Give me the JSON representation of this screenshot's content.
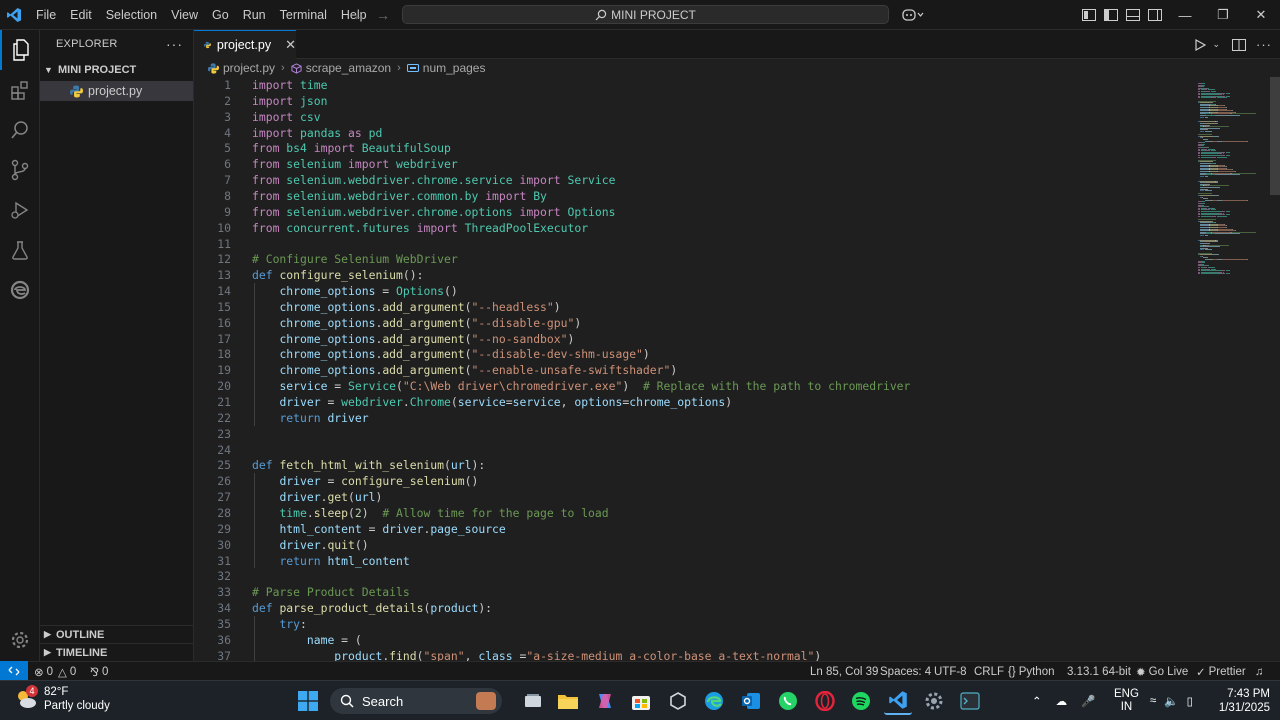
{
  "titlebar": {
    "menus": [
      "File",
      "Edit",
      "Selection",
      "View",
      "Go",
      "Run",
      "Terminal",
      "Help"
    ],
    "command_center": "MINI PROJECT"
  },
  "sidebar": {
    "title": "EXPLORER",
    "folder": "MINI PROJECT",
    "file": "project.py",
    "outline": "OUTLINE",
    "timeline": "TIMELINE"
  },
  "tab": {
    "label": "project.py"
  },
  "breadcrumb": {
    "file": "project.py",
    "function": "scrape_amazon",
    "variable": "num_pages"
  },
  "editor": {
    "lines": [
      [
        [
          "kw",
          "import"
        ],
        [
          "p",
          " "
        ],
        [
          "mod",
          "time"
        ]
      ],
      [
        [
          "kw",
          "import"
        ],
        [
          "p",
          " "
        ],
        [
          "mod",
          "json"
        ]
      ],
      [
        [
          "kw",
          "import"
        ],
        [
          "p",
          " "
        ],
        [
          "mod",
          "csv"
        ]
      ],
      [
        [
          "kw",
          "import"
        ],
        [
          "p",
          " "
        ],
        [
          "mod",
          "pandas"
        ],
        [
          "p",
          " "
        ],
        [
          "kw",
          "as"
        ],
        [
          "p",
          " "
        ],
        [
          "mod",
          "pd"
        ]
      ],
      [
        [
          "kw",
          "from"
        ],
        [
          "p",
          " "
        ],
        [
          "mod",
          "bs4"
        ],
        [
          "p",
          " "
        ],
        [
          "kw",
          "import"
        ],
        [
          "p",
          " "
        ],
        [
          "cls",
          "BeautifulSoup"
        ]
      ],
      [
        [
          "kw",
          "from"
        ],
        [
          "p",
          " "
        ],
        [
          "mod",
          "selenium"
        ],
        [
          "p",
          " "
        ],
        [
          "kw",
          "import"
        ],
        [
          "p",
          " "
        ],
        [
          "mod",
          "webdriver"
        ]
      ],
      [
        [
          "kw",
          "from"
        ],
        [
          "p",
          " "
        ],
        [
          "mod",
          "selenium.webdriver.chrome.service"
        ],
        [
          "p",
          " "
        ],
        [
          "kw",
          "import"
        ],
        [
          "p",
          " "
        ],
        [
          "cls",
          "Service"
        ]
      ],
      [
        [
          "kw",
          "from"
        ],
        [
          "p",
          " "
        ],
        [
          "mod",
          "selenium.webdriver.common.by"
        ],
        [
          "p",
          " "
        ],
        [
          "kw",
          "import"
        ],
        [
          "p",
          " "
        ],
        [
          "cls",
          "By"
        ]
      ],
      [
        [
          "kw",
          "from"
        ],
        [
          "p",
          " "
        ],
        [
          "mod",
          "selenium.webdriver.chrome.options"
        ],
        [
          "p",
          " "
        ],
        [
          "kw",
          "import"
        ],
        [
          "p",
          " "
        ],
        [
          "cls",
          "Options"
        ]
      ],
      [
        [
          "kw",
          "from"
        ],
        [
          "p",
          " "
        ],
        [
          "mod",
          "concurrent.futures"
        ],
        [
          "p",
          " "
        ],
        [
          "kw",
          "import"
        ],
        [
          "p",
          " "
        ],
        [
          "cls",
          "ThreadPoolExecutor"
        ]
      ],
      [],
      [
        [
          "cm",
          "# Configure Selenium WebDriver"
        ]
      ],
      [
        [
          "def",
          "def"
        ],
        [
          "p",
          " "
        ],
        [
          "fn",
          "configure_selenium"
        ],
        [
          "p",
          "():"
        ]
      ],
      [
        [
          "p",
          "    "
        ],
        [
          "var",
          "chrome_options"
        ],
        [
          "p",
          " = "
        ],
        [
          "cls",
          "Options"
        ],
        [
          "p",
          "()"
        ]
      ],
      [
        [
          "p",
          "    "
        ],
        [
          "var",
          "chrome_options"
        ],
        [
          "p",
          "."
        ],
        [
          "fn",
          "add_argument"
        ],
        [
          "p",
          "("
        ],
        [
          "str",
          "\"--headless\""
        ],
        [
          "p",
          ")"
        ]
      ],
      [
        [
          "p",
          "    "
        ],
        [
          "var",
          "chrome_options"
        ],
        [
          "p",
          "."
        ],
        [
          "fn",
          "add_argument"
        ],
        [
          "p",
          "("
        ],
        [
          "str",
          "\"--disable-gpu\""
        ],
        [
          "p",
          ")"
        ]
      ],
      [
        [
          "p",
          "    "
        ],
        [
          "var",
          "chrome_options"
        ],
        [
          "p",
          "."
        ],
        [
          "fn",
          "add_argument"
        ],
        [
          "p",
          "("
        ],
        [
          "str",
          "\"--no-sandbox\""
        ],
        [
          "p",
          ")"
        ]
      ],
      [
        [
          "p",
          "    "
        ],
        [
          "var",
          "chrome_options"
        ],
        [
          "p",
          "."
        ],
        [
          "fn",
          "add_argument"
        ],
        [
          "p",
          "("
        ],
        [
          "str",
          "\"--disable-dev-shm-usage\""
        ],
        [
          "p",
          ")"
        ]
      ],
      [
        [
          "p",
          "    "
        ],
        [
          "var",
          "chrome_options"
        ],
        [
          "p",
          "."
        ],
        [
          "fn",
          "add_argument"
        ],
        [
          "p",
          "("
        ],
        [
          "str",
          "\"--enable-unsafe-swiftshader\""
        ],
        [
          "p",
          ")"
        ]
      ],
      [
        [
          "p",
          "    "
        ],
        [
          "var",
          "service"
        ],
        [
          "p",
          " = "
        ],
        [
          "cls",
          "Service"
        ],
        [
          "p",
          "("
        ],
        [
          "str",
          "\"C:\\Web driver\\chromedriver.exe\""
        ],
        [
          "p",
          ")  "
        ],
        [
          "cm",
          "# Replace with the path to chromedriver"
        ]
      ],
      [
        [
          "p",
          "    "
        ],
        [
          "var",
          "driver"
        ],
        [
          "p",
          " = "
        ],
        [
          "mod",
          "webdriver"
        ],
        [
          "p",
          "."
        ],
        [
          "cls",
          "Chrome"
        ],
        [
          "p",
          "("
        ],
        [
          "var",
          "service"
        ],
        [
          "p",
          "="
        ],
        [
          "var",
          "service"
        ],
        [
          "p",
          ", "
        ],
        [
          "var",
          "options"
        ],
        [
          "p",
          "="
        ],
        [
          "var",
          "chrome_options"
        ],
        [
          "p",
          ")"
        ]
      ],
      [
        [
          "p",
          "    "
        ],
        [
          "def",
          "return"
        ],
        [
          "p",
          " "
        ],
        [
          "var",
          "driver"
        ]
      ],
      [],
      [],
      [
        [
          "def",
          "def"
        ],
        [
          "p",
          " "
        ],
        [
          "fn",
          "fetch_html_with_selenium"
        ],
        [
          "p",
          "("
        ],
        [
          "var",
          "url"
        ],
        [
          "p",
          "):"
        ]
      ],
      [
        [
          "p",
          "    "
        ],
        [
          "var",
          "driver"
        ],
        [
          "p",
          " = "
        ],
        [
          "fn",
          "configure_selenium"
        ],
        [
          "p",
          "()"
        ]
      ],
      [
        [
          "p",
          "    "
        ],
        [
          "var",
          "driver"
        ],
        [
          "p",
          "."
        ],
        [
          "fn",
          "get"
        ],
        [
          "p",
          "("
        ],
        [
          "var",
          "url"
        ],
        [
          "p",
          ")"
        ]
      ],
      [
        [
          "p",
          "    "
        ],
        [
          "mod",
          "time"
        ],
        [
          "p",
          "."
        ],
        [
          "fn",
          "sleep"
        ],
        [
          "p",
          "("
        ],
        [
          "num",
          "2"
        ],
        [
          "p",
          ")  "
        ],
        [
          "cm",
          "# Allow time for the page to load"
        ]
      ],
      [
        [
          "p",
          "    "
        ],
        [
          "var",
          "html_content"
        ],
        [
          "p",
          " = "
        ],
        [
          "var",
          "driver"
        ],
        [
          "p",
          "."
        ],
        [
          "var",
          "page_source"
        ]
      ],
      [
        [
          "p",
          "    "
        ],
        [
          "var",
          "driver"
        ],
        [
          "p",
          "."
        ],
        [
          "fn",
          "quit"
        ],
        [
          "p",
          "()"
        ]
      ],
      [
        [
          "p",
          "    "
        ],
        [
          "def",
          "return"
        ],
        [
          "p",
          " "
        ],
        [
          "var",
          "html_content"
        ]
      ],
      [],
      [
        [
          "cm",
          "# Parse Product Details"
        ]
      ],
      [
        [
          "def",
          "def"
        ],
        [
          "p",
          " "
        ],
        [
          "fn",
          "parse_product_details"
        ],
        [
          "p",
          "("
        ],
        [
          "var",
          "product"
        ],
        [
          "p",
          "):"
        ]
      ],
      [
        [
          "p",
          "    "
        ],
        [
          "def",
          "try"
        ],
        [
          "p",
          ":"
        ]
      ],
      [
        [
          "p",
          "        "
        ],
        [
          "var",
          "name"
        ],
        [
          "p",
          " = ("
        ]
      ],
      [
        [
          "p",
          "            "
        ],
        [
          "var",
          "product"
        ],
        [
          "p",
          "."
        ],
        [
          "fn",
          "find"
        ],
        [
          "p",
          "("
        ],
        [
          "str",
          "\"span\""
        ],
        [
          "p",
          ", "
        ],
        [
          "var",
          "class_"
        ],
        [
          "p",
          "="
        ],
        [
          "str",
          "\"a-size-medium a-color-base a-text-normal\""
        ],
        [
          "p",
          ")"
        ]
      ]
    ]
  },
  "statusbar": {
    "errors": "0",
    "warnings": "0",
    "ports": "0",
    "position": "Ln 85, Col 39",
    "spaces": "Spaces: 4",
    "encoding": "UTF-8",
    "eol": "CRLF",
    "language": "Python",
    "interpreter": "3.13.1 64-bit",
    "golive": "Go Live",
    "prettier": "Prettier"
  },
  "taskbar": {
    "temp": "82°F",
    "condition": "Partly cloudy",
    "weather_badge": "4",
    "search": "Search",
    "lang1": "ENG",
    "lang2": "IN",
    "time": "7:43 PM",
    "date": "1/31/2025"
  },
  "colors": {
    "kw": "#c586c0",
    "def": "#569cd6",
    "fn": "#dcdcaa",
    "cls": "#4ec9b0",
    "str": "#ce9178",
    "cm": "#6a9955",
    "num": "#b5cea8",
    "var": "#9cdcfe",
    "mod": "#4ec9b0",
    "p": "#cccccc",
    "accent": "#0078d4"
  }
}
